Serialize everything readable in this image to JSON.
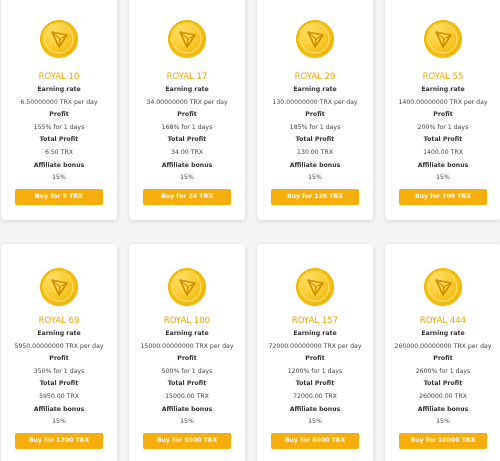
{
  "labels": {
    "earning_rate": "Earning rate",
    "profit": "Profit",
    "total_profit": "Total Profit",
    "affiliate_bonus": "Affiliate bonus"
  },
  "colors": {
    "accent": "#f6ae0d",
    "title": "#e6a400",
    "coin": "#f6c21c"
  },
  "icons": {
    "coin": "tron-coin-icon"
  },
  "plans": [
    {
      "title": "ROYAL 10",
      "earning_rate": "6.50000000 TRX per day",
      "profit": "155% for 1 days",
      "total_profit": "6.50 TRX",
      "affiliate_bonus": "15%",
      "button": "Buy for 5 TRX"
    },
    {
      "title": "ROYAL 17",
      "earning_rate": "34.00000000 TRX per day",
      "profit": "168% for 1 days",
      "total_profit": "34.00 TRX",
      "affiliate_bonus": "15%",
      "button": "Buy for 30 TRX"
    },
    {
      "title": "ROYAL 29",
      "earning_rate": "130.00000000 TRX per day",
      "profit": "185% for 1 days",
      "total_profit": "130.00 TRX",
      "affiliate_bonus": "15%",
      "button": "Buy for 120 TRX"
    },
    {
      "title": "ROYAL 55",
      "earning_rate": "1400.00000000 TRX per day",
      "profit": "200% for 1 days",
      "total_profit": "1400.00 TRX",
      "affiliate_bonus": "15%",
      "button": "Buy for 700 TRX"
    },
    {
      "title": "ROYAL  69",
      "earning_rate": "5950.00000000 TRX per day",
      "profit": "350% for 1 days",
      "total_profit": "5950.00 TRX",
      "affiliate_bonus": "15%",
      "button": "Buy for 1700 TRX"
    },
    {
      "title": "ROYAL 100",
      "earning_rate": "15000.00000000 TRX per day",
      "profit": "500% for 1 days",
      "total_profit": "15000.00 TRX",
      "affiliate_bonus": "15%",
      "button": "Buy for 3000 TRX"
    },
    {
      "title": "ROYAL 157",
      "earning_rate": "72000.00000000 TRX per day",
      "profit": "1200% for 1 days",
      "total_profit": "72000.00 TRX",
      "affiliate_bonus": "15%",
      "button": "Buy for 6000 TRX"
    },
    {
      "title": "ROYAL 444",
      "earning_rate": "260000.00000000 TRX per day",
      "profit": "2600% for 1 days",
      "total_profit": "260000.00 TRX",
      "affiliate_bonus": "15%",
      "button": "Buy for 10000 TRX"
    }
  ]
}
